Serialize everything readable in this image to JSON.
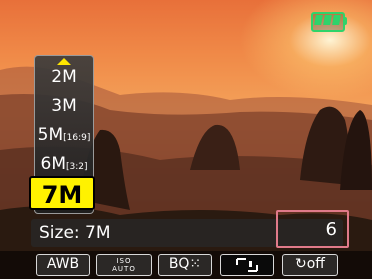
{
  "status": {
    "battery_icon": "battery-full-icon",
    "battery_level": 1.0,
    "battery_color": "#2fd36a"
  },
  "size_menu": {
    "items": [
      {
        "main": "2M",
        "sub": ""
      },
      {
        "main": "3M",
        "sub": ""
      },
      {
        "main": "5M",
        "sub": "[16:9]"
      },
      {
        "main": "6M",
        "sub": "[3:2]"
      }
    ],
    "selected": "7M",
    "selected_color": "#fff200"
  },
  "info_bar": {
    "size_label": "Size: 7M",
    "shots_remaining": "6",
    "highlight_color": "#e07a8a"
  },
  "toolbar": {
    "awb": "AWB",
    "iso_top": "ISO",
    "iso_bottom": "AUTO",
    "quality": "BQ⁙",
    "flash_icon": "metering-frame-icon",
    "self_timer": "↻off"
  }
}
